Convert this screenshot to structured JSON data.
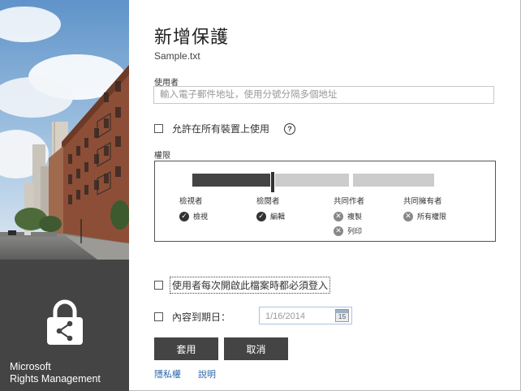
{
  "brand": {
    "line1": "Microsoft",
    "line2": "Rights Management"
  },
  "dialog": {
    "title": "新增保護",
    "file_name": "Sample.txt"
  },
  "users": {
    "label": "使用者",
    "placeholder": "輸入電子郵件地址，使用分號分隔多個地址",
    "value": ""
  },
  "allow_all_devices": {
    "label": "允許在所有裝置上使用",
    "checked": false,
    "help_glyph": "?"
  },
  "permissions": {
    "label": "權限",
    "selected_level": "檢閱者",
    "levels": [
      {
        "name": "檢視者",
        "items": [
          {
            "label": "檢視",
            "state": "granted"
          }
        ]
      },
      {
        "name": "檢閱者",
        "items": [
          {
            "label": "編輯",
            "state": "granted"
          }
        ]
      },
      {
        "name": "共同作者",
        "items": [
          {
            "label": "複製",
            "state": "denied"
          },
          {
            "label": "列印",
            "state": "denied"
          }
        ]
      },
      {
        "name": "共同擁有者",
        "items": [
          {
            "label": "所有權限",
            "state": "denied"
          }
        ]
      }
    ]
  },
  "require_login": {
    "label": "使用者每次開啟此檔案時都必須登入",
    "checked": false
  },
  "expiration": {
    "label": "內容到期日：",
    "checked": false,
    "date_value": "1/16/2014",
    "calendar_day": "15"
  },
  "buttons": {
    "apply": "套用",
    "cancel": "取消"
  },
  "links": {
    "privacy": "隱私權",
    "help": "說明"
  },
  "colors": {
    "dark_panel": "#444444",
    "link": "#2a66a8",
    "granted_icon": "#333333",
    "denied_icon": "#888888"
  }
}
